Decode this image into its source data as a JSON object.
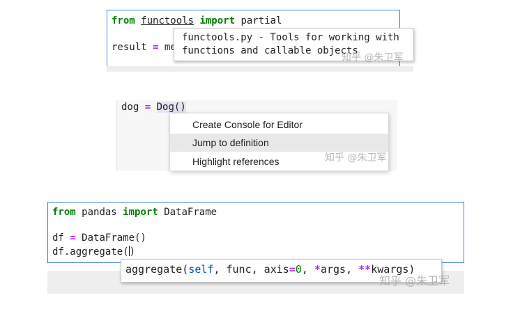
{
  "panel1": {
    "line1": {
      "kw_from": "from",
      "module": "functools",
      "kw_import": "import",
      "name": "partial"
    },
    "line2": {
      "var": "result",
      "op": "=",
      "rest": "me"
    },
    "tooltip": {
      "line1": "functools.py - Tools for working with",
      "line2": "functions and callable objects"
    },
    "watermark": "知乎 @朱卫军"
  },
  "panel2": {
    "code": {
      "var": "dog",
      "op": "=",
      "call": "Dog()"
    },
    "menu_items": [
      "Create Console for Editor",
      "Jump to definition",
      "Highlight references"
    ],
    "watermark": "知乎 @朱卫军"
  },
  "panel3": {
    "line1": {
      "kw_from": "from",
      "module": "pandas",
      "kw_import": "import",
      "name": "DataFrame"
    },
    "line2": {
      "var": "df",
      "op": "=",
      "call": "DataFrame()"
    },
    "line3": {
      "prefix": "df.aggregate(",
      "suffix": ")"
    },
    "tooltip": {
      "fn": "aggregate(",
      "self": "self",
      "mid": ", func, axis",
      "eq": "=",
      "zero": "0",
      "c1": ", ",
      "star1": "*",
      "args": "args, ",
      "star2": "**",
      "kwargs": "kwargs)"
    },
    "watermark": "知乎 @朱卫军"
  }
}
